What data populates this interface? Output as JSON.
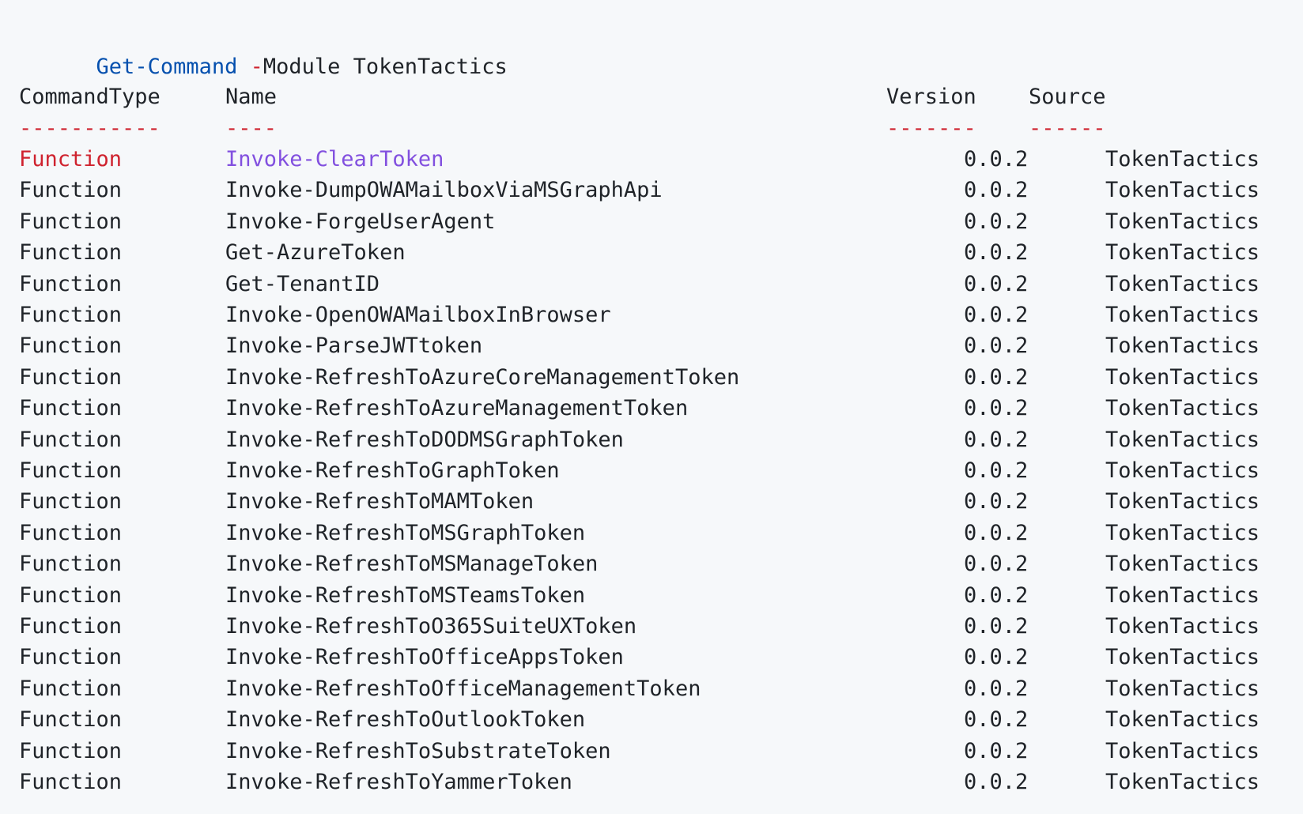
{
  "command": {
    "cmdlet": "Get-Command",
    "param_dash": "-",
    "param_rest": "Module TokenTactics"
  },
  "headers": {
    "type": "CommandType",
    "name": "Name",
    "version": "Version",
    "source": "Source"
  },
  "underlines": {
    "type": "-----------",
    "name": "----",
    "version": "-------",
    "source": "------"
  },
  "rows": [
    {
      "type": "Function",
      "name": "Invoke-ClearToken",
      "version": "0.0.2",
      "source": "TokenTactics"
    },
    {
      "type": "Function",
      "name": "Invoke-DumpOWAMailboxViaMSGraphApi",
      "version": "0.0.2",
      "source": "TokenTactics"
    },
    {
      "type": "Function",
      "name": "Invoke-ForgeUserAgent",
      "version": "0.0.2",
      "source": "TokenTactics"
    },
    {
      "type": "Function",
      "name": "Get-AzureToken",
      "version": "0.0.2",
      "source": "TokenTactics"
    },
    {
      "type": "Function",
      "name": "Get-TenantID",
      "version": "0.0.2",
      "source": "TokenTactics"
    },
    {
      "type": "Function",
      "name": "Invoke-OpenOWAMailboxInBrowser",
      "version": "0.0.2",
      "source": "TokenTactics"
    },
    {
      "type": "Function",
      "name": "Invoke-ParseJWTtoken",
      "version": "0.0.2",
      "source": "TokenTactics"
    },
    {
      "type": "Function",
      "name": "Invoke-RefreshToAzureCoreManagementToken",
      "version": "0.0.2",
      "source": "TokenTactics"
    },
    {
      "type": "Function",
      "name": "Invoke-RefreshToAzureManagementToken",
      "version": "0.0.2",
      "source": "TokenTactics"
    },
    {
      "type": "Function",
      "name": "Invoke-RefreshToDODMSGraphToken",
      "version": "0.0.2",
      "source": "TokenTactics"
    },
    {
      "type": "Function",
      "name": "Invoke-RefreshToGraphToken",
      "version": "0.0.2",
      "source": "TokenTactics"
    },
    {
      "type": "Function",
      "name": "Invoke-RefreshToMAMToken",
      "version": "0.0.2",
      "source": "TokenTactics"
    },
    {
      "type": "Function",
      "name": "Invoke-RefreshToMSGraphToken",
      "version": "0.0.2",
      "source": "TokenTactics"
    },
    {
      "type": "Function",
      "name": "Invoke-RefreshToMSManageToken",
      "version": "0.0.2",
      "source": "TokenTactics"
    },
    {
      "type": "Function",
      "name": "Invoke-RefreshToMSTeamsToken",
      "version": "0.0.2",
      "source": "TokenTactics"
    },
    {
      "type": "Function",
      "name": "Invoke-RefreshToO365SuiteUXToken",
      "version": "0.0.2",
      "source": "TokenTactics"
    },
    {
      "type": "Function",
      "name": "Invoke-RefreshToOfficeAppsToken",
      "version": "0.0.2",
      "source": "TokenTactics"
    },
    {
      "type": "Function",
      "name": "Invoke-RefreshToOfficeManagementToken",
      "version": "0.0.2",
      "source": "TokenTactics"
    },
    {
      "type": "Function",
      "name": "Invoke-RefreshToOutlookToken",
      "version": "0.0.2",
      "source": "TokenTactics"
    },
    {
      "type": "Function",
      "name": "Invoke-RefreshToSubstrateToken",
      "version": "0.0.2",
      "source": "TokenTactics"
    },
    {
      "type": "Function",
      "name": "Invoke-RefreshToYammerToken",
      "version": "0.0.2",
      "source": "TokenTactics"
    }
  ],
  "colors": {
    "background": "#f6f8fa",
    "text": "#1f2328",
    "cmdlet": "#0550ae",
    "dash": "#cf222e",
    "highlight_name": "#8250df"
  }
}
